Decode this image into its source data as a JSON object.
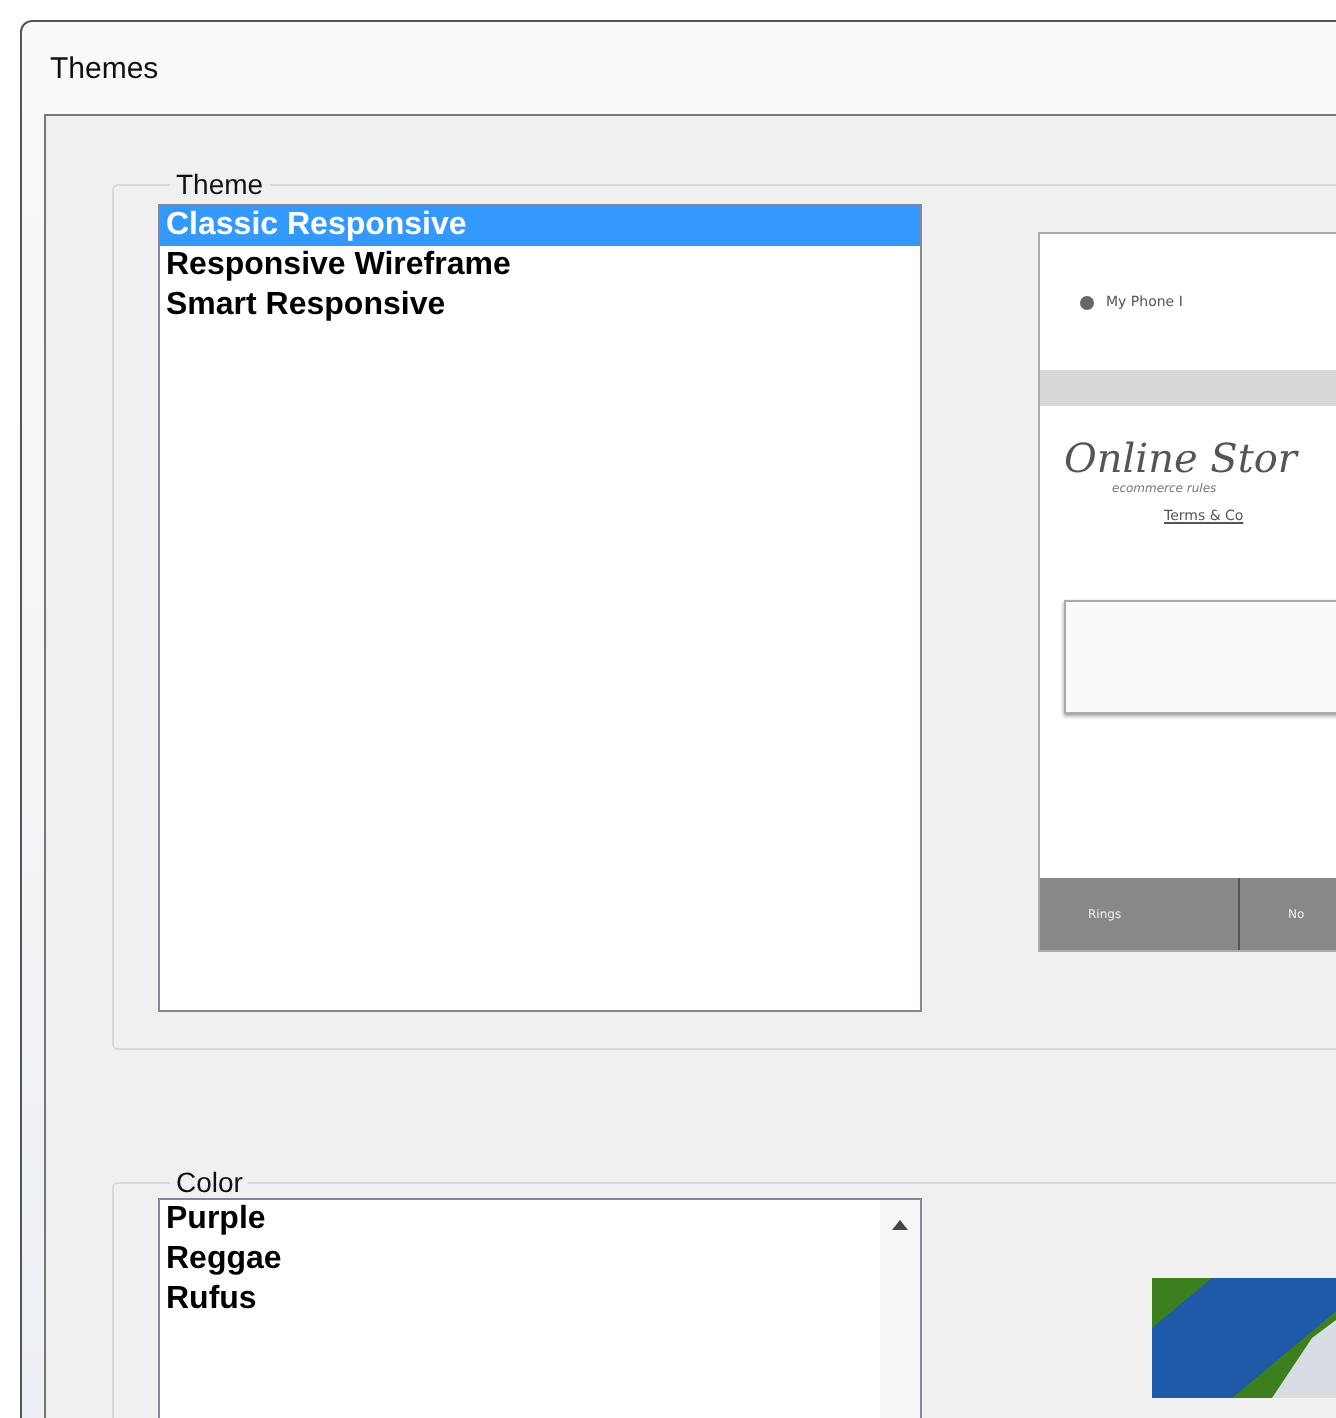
{
  "window": {
    "title": "Themes"
  },
  "theme_group": {
    "legend": "Theme",
    "items": [
      {
        "label": "Classic Responsive",
        "selected": true
      },
      {
        "label": "Responsive Wireframe",
        "selected": false
      },
      {
        "label": "Smart Responsive",
        "selected": false
      }
    ],
    "preview": {
      "header_text": "My Phone I",
      "logo": "Online Stor",
      "tagline": "ecommerce rules",
      "link": "Terms & Co",
      "nav": [
        "Rings",
        "No"
      ]
    }
  },
  "color_group": {
    "legend": "Color",
    "items": [
      {
        "label": "Purple",
        "selected": false
      },
      {
        "label": "Reggae",
        "selected": false
      },
      {
        "label": "Rufus",
        "selected": false
      }
    ]
  }
}
